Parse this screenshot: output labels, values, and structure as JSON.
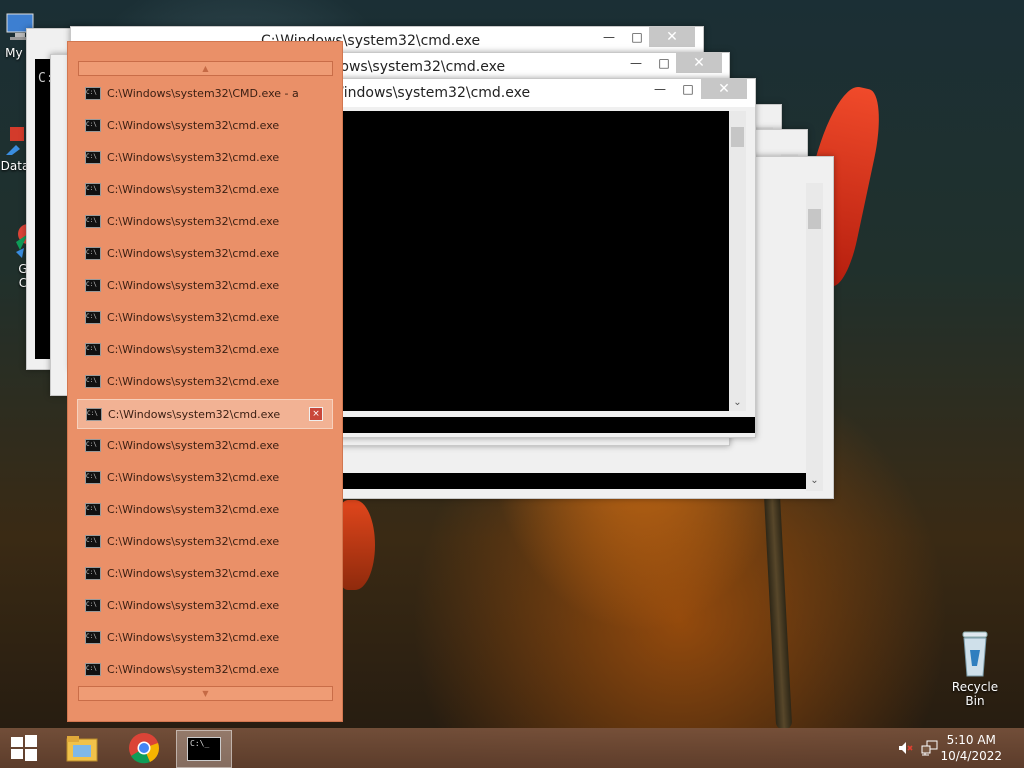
{
  "desktop": {
    "icons": [
      {
        "label": "My C",
        "glyph": "computer-icon"
      },
      {
        "label": "Data",
        "glyph": "data-icon"
      },
      {
        "label": "G",
        "label2": "C",
        "glyph": "chrome-shortcut-icon"
      },
      {
        "label": "Recycle Bin",
        "glyph": "recycle-bin-icon"
      }
    ]
  },
  "windows": [
    {
      "title": "C:\\Windows\\system32\\cmd.exe"
    },
    {
      "title": "C:\\Windows\\system32\\cmd.exe"
    },
    {
      "title": "C:\\Windows\\system32\\cmd.exe"
    }
  ],
  "back_window_text": "C:",
  "panel": {
    "up_arrow": "▲",
    "down_arrow": "▼",
    "items": [
      "C:\\Windows\\system32\\CMD.exe - a",
      "C:\\Windows\\system32\\cmd.exe",
      "C:\\Windows\\system32\\cmd.exe",
      "C:\\Windows\\system32\\cmd.exe",
      "C:\\Windows\\system32\\cmd.exe",
      "C:\\Windows\\system32\\cmd.exe",
      "C:\\Windows\\system32\\cmd.exe",
      "C:\\Windows\\system32\\cmd.exe",
      "C:\\Windows\\system32\\cmd.exe",
      "C:\\Windows\\system32\\cmd.exe",
      "C:\\Windows\\system32\\cmd.exe",
      "C:\\Windows\\system32\\cmd.exe",
      "C:\\Windows\\system32\\cmd.exe",
      "C:\\Windows\\system32\\cmd.exe",
      "C:\\Windows\\system32\\cmd.exe",
      "C:\\Windows\\system32\\cmd.exe",
      "C:\\Windows\\system32\\cmd.exe",
      "C:\\Windows\\system32\\cmd.exe",
      "C:\\Windows\\system32\\cmd.exe"
    ],
    "selected_index": 10,
    "item_icon_text": "C:\\",
    "close_glyph": "×"
  },
  "controls": {
    "min": "—",
    "max": "□",
    "close": "✕",
    "scroll_down": "⌄"
  },
  "taskbar": {
    "cmd_icon_text": "C:\\_",
    "time": "5:10 AM",
    "date": "10/4/2022"
  },
  "colors": {
    "panel": "#ea9068",
    "selected": "#f2b294",
    "taskbar": "#6e4a36"
  }
}
